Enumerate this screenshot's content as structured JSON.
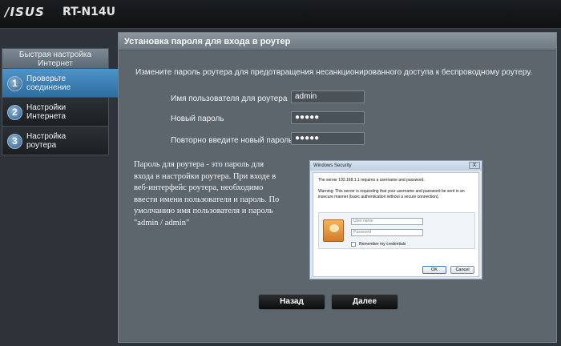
{
  "header": {
    "brand": "/ISUS",
    "model": "RT-N14U"
  },
  "sidebar": {
    "title_line1": "Быстрая настройка",
    "title_line2": "Интернет",
    "steps": [
      {
        "num": "1",
        "line1": "Проверьте",
        "line2": "соединение",
        "active": true
      },
      {
        "num": "2",
        "line1": "Настройки",
        "line2": "Интернета",
        "active": false
      },
      {
        "num": "3",
        "line1": "Настройка",
        "line2": "роутера",
        "active": false
      }
    ]
  },
  "panel": {
    "title": "Установка пароля для входа в роутер",
    "intro": "Измените пароль роутера для предотвращения несанкционированного доступа к беспроводному роутеру.",
    "fields": [
      {
        "label": "Имя пользователя для роутера",
        "value": "admin"
      },
      {
        "label": "Новый пароль",
        "value": "●●●●●"
      },
      {
        "label": "Повторно введите новый пароль",
        "value": "●●●●●"
      }
    ],
    "description_lines": [
      "Пароль для роутера - это пароль для",
      "входа в настройки роутера. При входе в",
      "веб-интерфейс роутера, необходимо",
      "ввести имени пользователя и пароль. По",
      "умолчанию имя пользователя и пароль",
      "\"admin / admin\""
    ]
  },
  "dialog": {
    "title": "Windows Security",
    "close": "X",
    "server_text": "The server 192.168.1.1 requires a username and password.",
    "warning_text": "Warning: This server is requesting that your username and password be sent in an insecure manner (basic authentication without a secure connection).",
    "username_placeholder": "User name",
    "password_placeholder": "Password",
    "remember_label": "Remember my credentials",
    "ok_label": "OK",
    "cancel_label": "Cancel"
  },
  "buttons": {
    "back": "Назад",
    "next": "Далее"
  }
}
